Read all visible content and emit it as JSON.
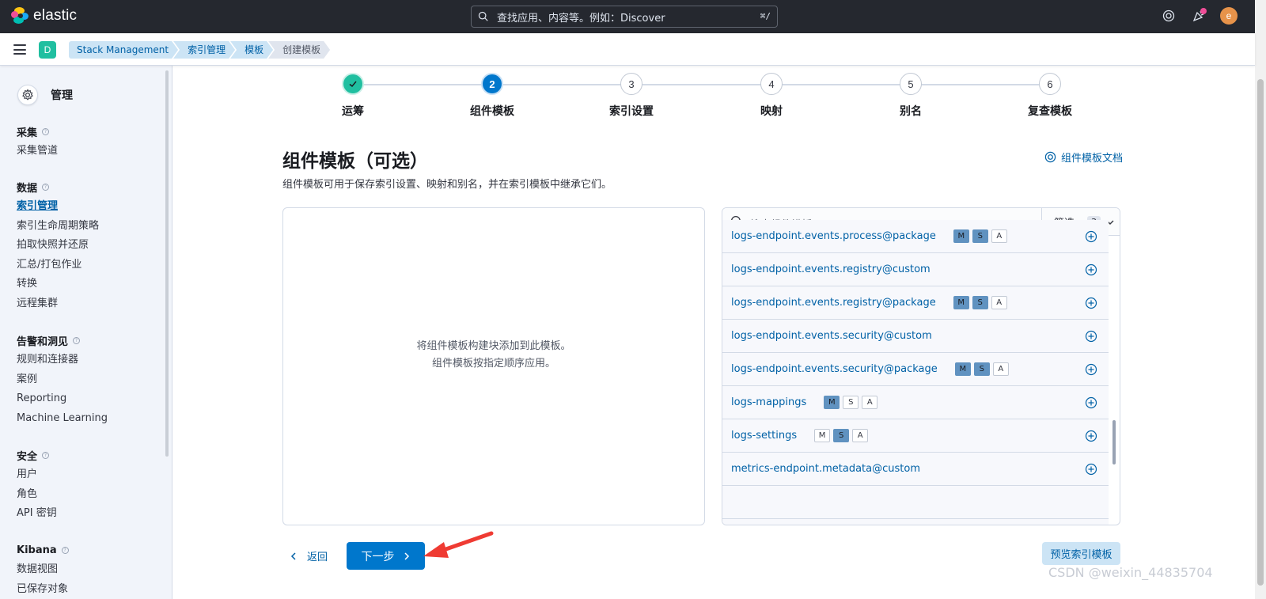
{
  "header": {
    "logo_text": "elastic",
    "search_placeholder": "查找应用、内容等。例如：Discover",
    "search_shortcut": "⌘/",
    "avatar_initial": "e"
  },
  "breadcrumb": {
    "space_initial": "D",
    "items": [
      "Stack Management",
      "索引管理",
      "模板",
      "创建模板"
    ]
  },
  "sidebar": {
    "title": "管理",
    "groups": [
      {
        "title": "采集",
        "items": [
          "采集管道"
        ]
      },
      {
        "title": "数据",
        "items": [
          "索引管理",
          "索引生命周期策略",
          "拍取快照并还原",
          "汇总/打包作业",
          "转换",
          "远程集群"
        ]
      },
      {
        "title": "告警和洞见",
        "items": [
          "规则和连接器",
          "案例",
          "Reporting",
          "Machine Learning"
        ]
      },
      {
        "title": "安全",
        "items": [
          "用户",
          "角色",
          "API 密钥"
        ]
      },
      {
        "title": "Kibana",
        "items": [
          "数据视图",
          "已保存对象"
        ]
      }
    ],
    "active_item": "索引管理"
  },
  "steps": [
    {
      "number": "✓",
      "label": "运筹",
      "state": "done"
    },
    {
      "number": "2",
      "label": "组件模板",
      "state": "current"
    },
    {
      "number": "3",
      "label": "索引设置",
      "state": "pending"
    },
    {
      "number": "4",
      "label": "映射",
      "state": "pending"
    },
    {
      "number": "5",
      "label": "别名",
      "state": "pending"
    },
    {
      "number": "6",
      "label": "复查模板",
      "state": "pending"
    }
  ],
  "main": {
    "title": "组件模板（可选）",
    "description": "组件模板可用于保存索引设置、映射和别名，并在索引模板中继承它们。",
    "doc_link": "组件模板文档",
    "empty_line1": "将组件模板构建块添加到此模板。",
    "empty_line2": "组件模板按指定顺序应用。"
  },
  "component_list": {
    "search_placeholder": "搜索组件模板",
    "filter_label": "筛选",
    "filter_count": "3",
    "rows": [
      {
        "name": "logs-endpoint.events.process@package",
        "badges": [
          {
            "t": "M",
            "on": true
          },
          {
            "t": "S",
            "on": true
          },
          {
            "t": "A",
            "on": false
          }
        ]
      },
      {
        "name": "logs-endpoint.events.registry@custom",
        "badges": []
      },
      {
        "name": "logs-endpoint.events.registry@package",
        "badges": [
          {
            "t": "M",
            "on": true
          },
          {
            "t": "S",
            "on": true
          },
          {
            "t": "A",
            "on": false
          }
        ]
      },
      {
        "name": "logs-endpoint.events.security@custom",
        "badges": []
      },
      {
        "name": "logs-endpoint.events.security@package",
        "badges": [
          {
            "t": "M",
            "on": true
          },
          {
            "t": "S",
            "on": true
          },
          {
            "t": "A",
            "on": false
          }
        ]
      },
      {
        "name": "logs-mappings",
        "badges": [
          {
            "t": "M",
            "on": true
          },
          {
            "t": "S",
            "on": false
          },
          {
            "t": "A",
            "on": false
          }
        ]
      },
      {
        "name": "logs-settings",
        "badges": [
          {
            "t": "M",
            "on": false
          },
          {
            "t": "S",
            "on": true
          },
          {
            "t": "A",
            "on": false
          }
        ]
      },
      {
        "name": "metrics-endpoint.metadata@custom",
        "badges": []
      }
    ]
  },
  "footer": {
    "back_label": "返回",
    "next_label": "下一步",
    "preview_label": "预览索引模板"
  },
  "watermark": "CSDN @weixin_44835704",
  "colors": {
    "primary": "#0077cc",
    "header_bg": "#25282f",
    "success": "#20bfa0",
    "badge_on": "#6092c0"
  }
}
